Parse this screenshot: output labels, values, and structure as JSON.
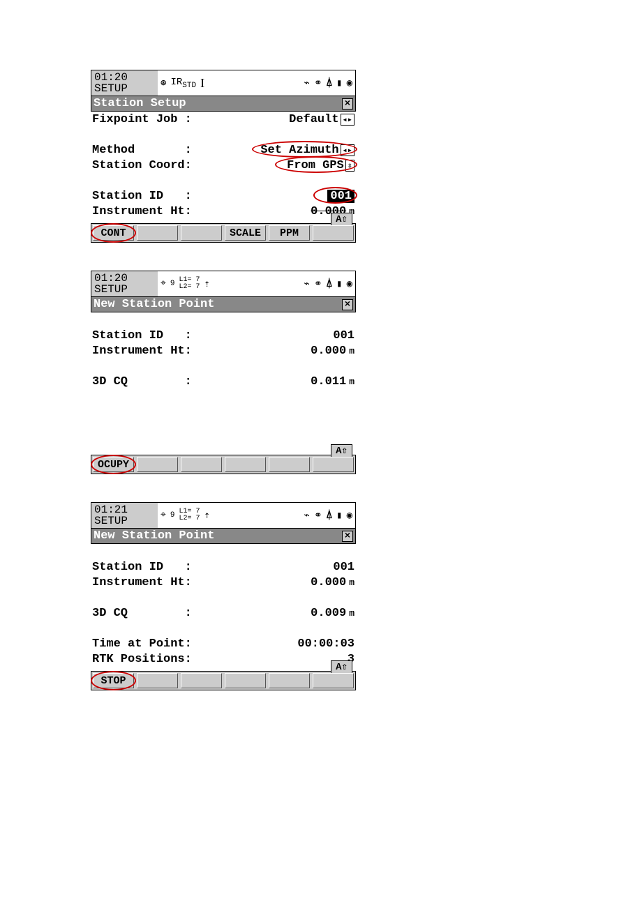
{
  "screens": [
    {
      "time": "01:20",
      "mode": "SETUP",
      "ir_label": "IR",
      "ir_sub": "STD",
      "title": "Station Setup",
      "rows": [
        {
          "label": "Fixpoint Job :",
          "value": "Default",
          "arrows": "lr"
        },
        {
          "gap": true
        },
        {
          "label": "Method       :",
          "value": "Set Azimuth",
          "arrows": "lr",
          "circled": true
        },
        {
          "label": "Station Coord:",
          "value": "From GPS",
          "arrows": "ud",
          "circled": true
        },
        {
          "gap": true
        },
        {
          "label": "Station ID   :",
          "value": "001",
          "selected": true,
          "circled": true
        },
        {
          "label": "Instrument Ht:",
          "value": "0.000",
          "unit": "m",
          "strike": true
        }
      ],
      "softkeys": [
        "CONT",
        "",
        "",
        "SCALE",
        "PPM",
        ""
      ],
      "softkey_circled_index": 0,
      "aup": "A⇧"
    },
    {
      "time": "01:20",
      "mode": "SETUP",
      "l1": "L1= 7",
      "l2": "L2= 7",
      "sat": "9",
      "title": "New Station Point",
      "rows": [
        {
          "gap": true
        },
        {
          "label": "Station ID   :",
          "value": "001"
        },
        {
          "label": "Instrument Ht:",
          "value": "0.000",
          "unit": "m"
        },
        {
          "gap": true
        },
        {
          "label": "3D CQ        :",
          "value": "0.011",
          "unit": "m"
        }
      ],
      "softkeys": [
        "OCUPY",
        "",
        "",
        "",
        "",
        ""
      ],
      "softkey_circled_index": 0,
      "aup": "A⇧"
    },
    {
      "time": "01:21",
      "mode": "SETUP",
      "l1": "L1= 7",
      "l2": "L2= 7",
      "sat": "9",
      "title": "New Station Point",
      "rows": [
        {
          "gap": true
        },
        {
          "label": "Station ID   :",
          "value": "001"
        },
        {
          "label": "Instrument Ht:",
          "value": "0.000",
          "unit": "m"
        },
        {
          "gap": true
        },
        {
          "label": "3D CQ        :",
          "value": "0.009",
          "unit": "m"
        },
        {
          "gap": true
        },
        {
          "label": "Time at Point:",
          "value": "00:00:03"
        },
        {
          "label": "RTK Positions:",
          "value": "3"
        }
      ],
      "softkeys": [
        "STOP",
        "",
        "",
        "",
        "",
        ""
      ],
      "softkey_circled_index": 0,
      "aup": "A⇧"
    }
  ],
  "icons": {
    "compass": "⊛",
    "bluetooth": "⌁",
    "sat": "⛰",
    "tripod": "ᗐ",
    "tribrach": "⌖",
    "battery": "▮",
    "disk": "◉",
    "i": "I",
    "walk": "🚶"
  }
}
